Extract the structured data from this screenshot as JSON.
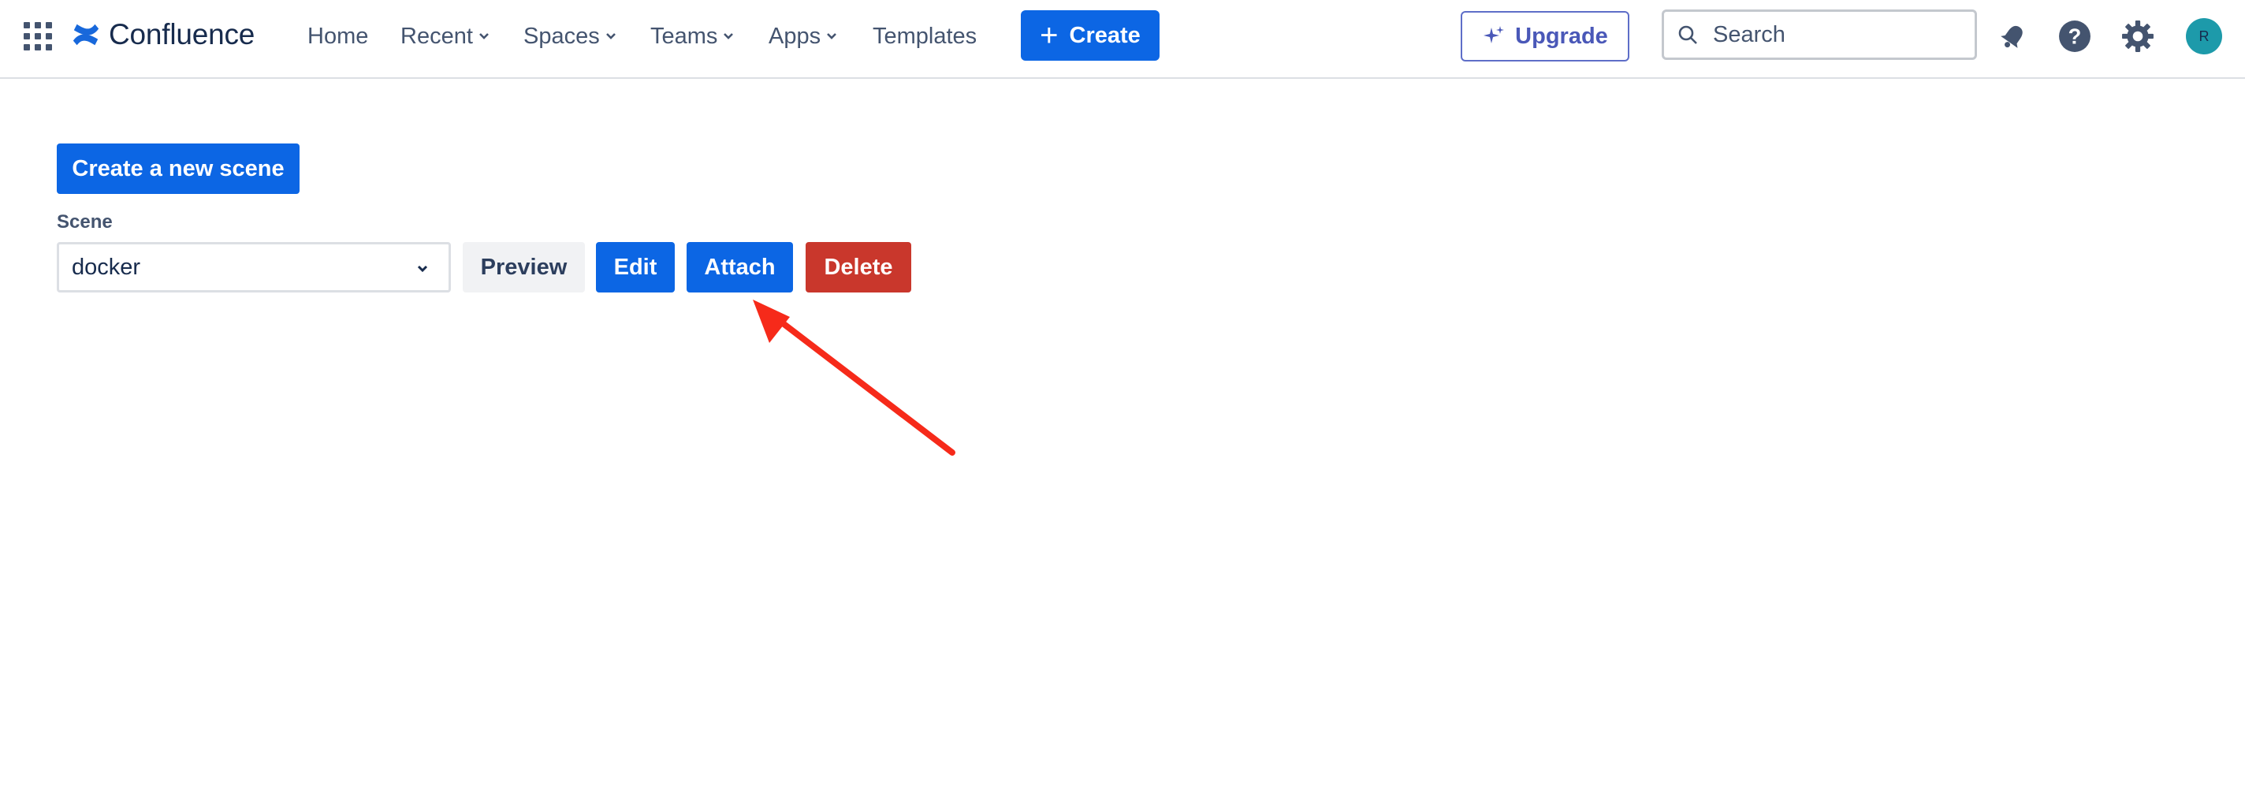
{
  "header": {
    "app_name": "Confluence",
    "nav": [
      {
        "label": "Home",
        "has_menu": false
      },
      {
        "label": "Recent",
        "has_menu": true
      },
      {
        "label": "Spaces",
        "has_menu": true
      },
      {
        "label": "Teams",
        "has_menu": true
      },
      {
        "label": "Apps",
        "has_menu": true
      },
      {
        "label": "Templates",
        "has_menu": false
      }
    ],
    "create_label": "Create",
    "upgrade_label": "Upgrade",
    "search_placeholder": "Search",
    "avatar_initial": "R",
    "icons": [
      "app-switcher-icon",
      "notifications-icon",
      "help-icon",
      "settings-icon"
    ]
  },
  "main": {
    "create_scene_label": "Create a new scene",
    "scene_label": "Scene",
    "scene_value": "docker",
    "preview_label": "Preview",
    "edit_label": "Edit",
    "attach_label": "Attach",
    "delete_label": "Delete"
  },
  "colors": {
    "primary": "#0c66e4",
    "danger": "#c9372c",
    "annotation_arrow": "#f62a1a",
    "avatar": "#1d9aaa"
  }
}
